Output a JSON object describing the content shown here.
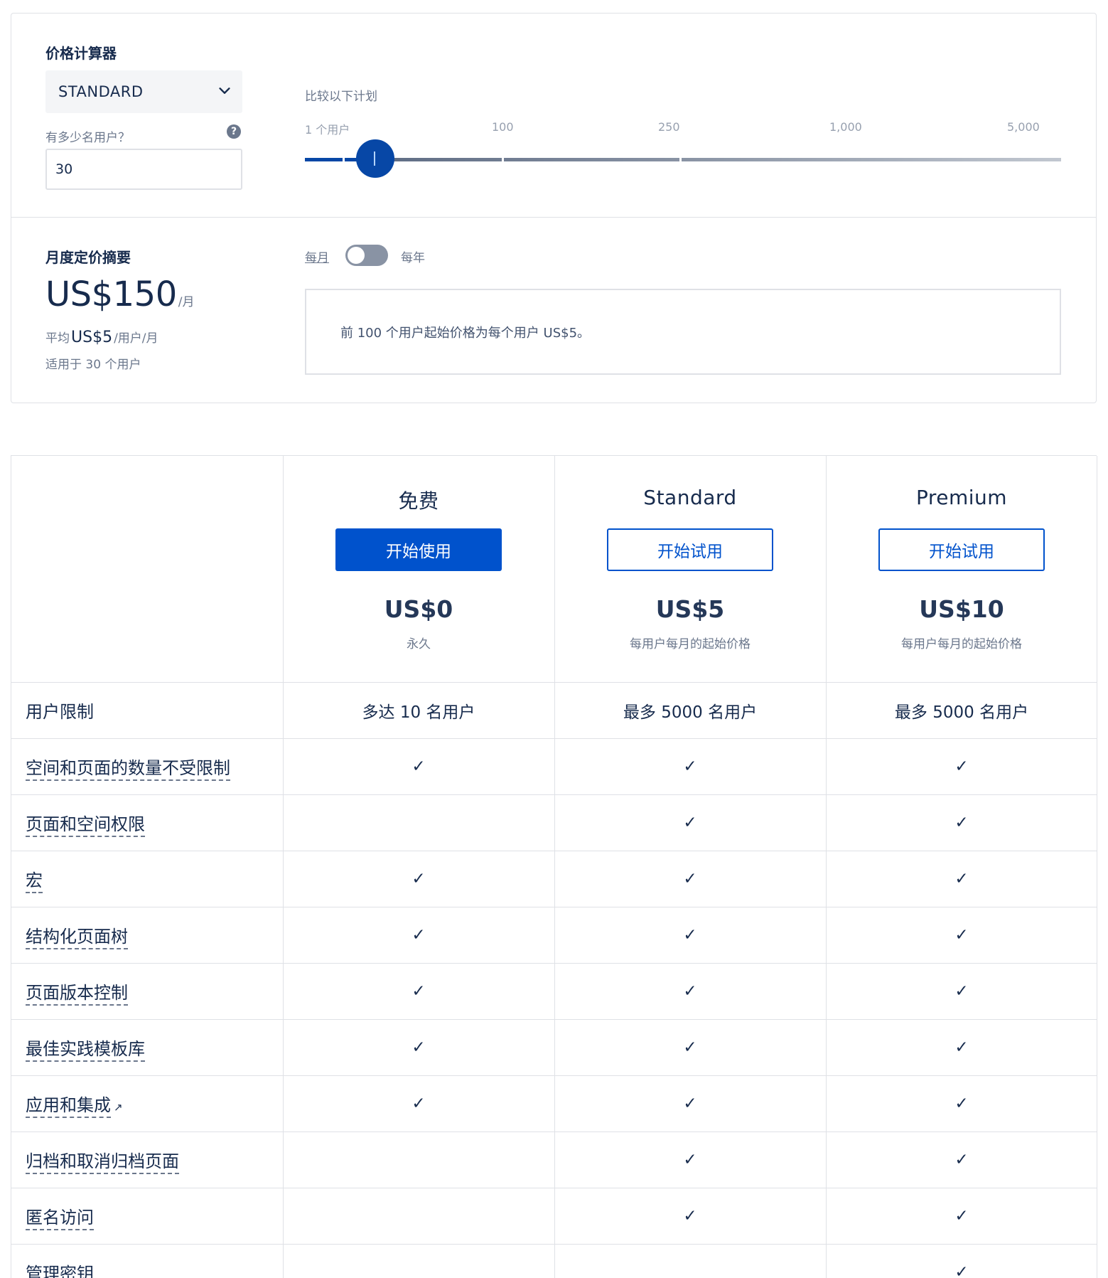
{
  "calculator": {
    "title": "价格计算器",
    "plan_select": "STANDARD",
    "users_label": "有多少名用户？",
    "help_icon": "?",
    "users_value": "30",
    "compare_label": "比较以下计划",
    "ticks": [
      "1 个用户",
      "100",
      "250",
      "1,000",
      "5,000"
    ],
    "slider_users": 30
  },
  "summary": {
    "title": "月度定价摘要",
    "price": "US$150",
    "per": "/月",
    "avg_prefix": "平均",
    "avg_amount": "US$5",
    "avg_suffix": "/用户/月",
    "applies": "适用于 30 个用户",
    "monthly": "每月",
    "yearly": "每年",
    "info": "前 100 个用户起始价格为每个用户 US$5。"
  },
  "plans": [
    {
      "name": "免费",
      "button": "开始使用",
      "price": "US$0",
      "sub": "永久"
    },
    {
      "name": "Standard",
      "button": "开始试用",
      "price": "US$5",
      "sub": "每用户每月的起始价格"
    },
    {
      "name": "Premium",
      "button": "开始试用",
      "price": "US$10",
      "sub": "每用户每月的起始价格"
    }
  ],
  "features": [
    {
      "label": "用户限制",
      "values": [
        "多达 10 名用户",
        "最多 5000 名用户",
        "最多 5000 名用户"
      ]
    },
    {
      "label": "空间和页面的数量不受限制",
      "values": [
        "✓",
        "✓",
        "✓"
      ]
    },
    {
      "label": "页面和空间权限",
      "values": [
        "",
        "✓",
        "✓"
      ]
    },
    {
      "label": "宏",
      "values": [
        "✓",
        "✓",
        "✓"
      ]
    },
    {
      "label": "结构化页面树",
      "values": [
        "✓",
        "✓",
        "✓"
      ]
    },
    {
      "label": "页面版本控制",
      "values": [
        "✓",
        "✓",
        "✓"
      ]
    },
    {
      "label": "最佳实践模板库",
      "values": [
        "✓",
        "✓",
        "✓"
      ]
    },
    {
      "label": "应用和集成",
      "ext_icon": "↗",
      "values": [
        "✓",
        "✓",
        "✓"
      ]
    },
    {
      "label": "归档和取消归档页面",
      "values": [
        "",
        "✓",
        "✓"
      ]
    },
    {
      "label": "匿名访问",
      "values": [
        "",
        "✓",
        "✓"
      ]
    },
    {
      "label": "管理密钥",
      "values": [
        "",
        "",
        "✓"
      ]
    }
  ],
  "icons": {
    "dropdown": "chevron-down-icon",
    "help": "question-circle-icon",
    "check": "checkmark-icon",
    "external": "external-link-icon"
  },
  "colors": {
    "primary": "#0052cc",
    "slider": "#0747a6",
    "text": "#172b4d",
    "muted": "#6b778c",
    "border": "#dfe1e6"
  }
}
